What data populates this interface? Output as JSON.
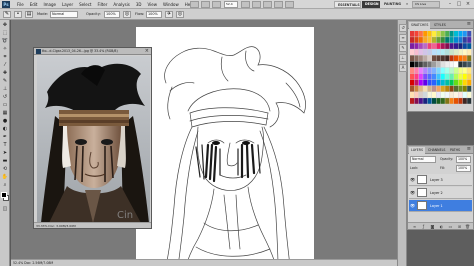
{
  "app": {
    "logo": "Ps",
    "menus": [
      "File",
      "Edit",
      "Image",
      "Layer",
      "Select",
      "Filter",
      "Analysis",
      "3D",
      "View",
      "Window",
      "Help"
    ],
    "zoom_select": "52.4",
    "workspaces": {
      "essentials": "ESSENTIALS",
      "design": "DESIGN",
      "painting": "PAINTING",
      "more": "»"
    },
    "cs_live": "CS Live",
    "window_controls": {
      "minimize": "–",
      "maximize": "□",
      "close": "×"
    }
  },
  "options": {
    "mode_label": "Mode:",
    "mode_value": "Normal",
    "opacity_label": "Opacity:",
    "opacity_value": "100%",
    "flow_label": "Flow:",
    "flow_value": "100%"
  },
  "reference_window": {
    "title": "tto...d-Cigar-2013_04-26...jpg @ 33.4% (RGB/8)",
    "status": "33.33%   Doc: 3.00M/3.00M"
  },
  "status_bar": {
    "text": "52.4%   Doc: 2.56M/7.08M"
  },
  "swatches_panel": {
    "tabs": [
      "SWATCHES",
      "STYLES"
    ],
    "colors": [
      "#e53935",
      "#f44336",
      "#ff7043",
      "#ff9800",
      "#ffc107",
      "#ffeb3b",
      "#cddc39",
      "#8bc34a",
      "#4caf50",
      "#009688",
      "#00bcd4",
      "#03a9f4",
      "#2196f3",
      "#3f51b5",
      "#c62828",
      "#d84315",
      "#ef6c00",
      "#f9a825",
      "#fbc02d",
      "#afb42b",
      "#689f38",
      "#388e3c",
      "#00796b",
      "#0097a7",
      "#0288d1",
      "#1976d2",
      "#303f9f",
      "#512da8",
      "#7b1fa2",
      "#8e24aa",
      "#ab47bc",
      "#ba68c8",
      "#ec407a",
      "#f06292",
      "#e91e63",
      "#ad1457",
      "#880e4f",
      "#4a148c",
      "#311b92",
      "#1a237e",
      "#0d47a1",
      "#01579b",
      "#ffcdd2",
      "#f8bbd0",
      "#e1bee7",
      "#d1c4e9",
      "#c5cae9",
      "#bbdefb",
      "#b3e5fc",
      "#b2ebf2",
      "#b2dfdb",
      "#c8e6c9",
      "#dcedc8",
      "#f0f4c3",
      "#fff9c4",
      "#ffecb3",
      "#795548",
      "#8d6e63",
      "#a1887f",
      "#bcaaa4",
      "#d7ccc8",
      "#6d4c41",
      "#5d4037",
      "#4e342e",
      "#3e2723",
      "#bf360c",
      "#e65100",
      "#ff6f00",
      "#f57f17",
      "#827717",
      "#000000",
      "#212121",
      "#424242",
      "#616161",
      "#757575",
      "#9e9e9e",
      "#bdbdbd",
      "#e0e0e0",
      "#eeeeee",
      "#f5f5f5",
      "#ffffff",
      "#263238",
      "#37474f",
      "#455a64",
      "#ff8a80",
      "#ff80ab",
      "#ea80fc",
      "#b388ff",
      "#8c9eff",
      "#82b1ff",
      "#80d8ff",
      "#84ffff",
      "#a7ffeb",
      "#b9f6ca",
      "#ccff90",
      "#f4ff81",
      "#ffff8d",
      "#ffe57f",
      "#ff5252",
      "#ff4081",
      "#e040fb",
      "#7c4dff",
      "#536dfe",
      "#448aff",
      "#40c4ff",
      "#18ffff",
      "#64ffda",
      "#69f0ae",
      "#b2ff59",
      "#eeff41",
      "#ffff00",
      "#ffd740",
      "#d50000",
      "#c51162",
      "#aa00ff",
      "#6200ea",
      "#304ffe",
      "#2962ff",
      "#0091ea",
      "#00b8d4",
      "#00bfa5",
      "#00c853",
      "#64dd17",
      "#aeea00",
      "#ffd600",
      "#ffab00",
      "#a0522d",
      "#cd853f",
      "#deb887",
      "#f5deb3",
      "#d2b48c",
      "#bc8f8f",
      "#f4a460",
      "#daa520",
      "#b8860b",
      "#8b4513",
      "#556b2f",
      "#6b8e23",
      "#808000",
      "#2f4f4f",
      "#ffe0b2",
      "#ffccbc",
      "#d7ccc8",
      "#cfd8dc",
      "#f5f5dc",
      "#fffacd",
      "#e6e6fa",
      "#f0fff0",
      "#f0f8ff",
      "#faebd7",
      "#fdf5e6",
      "#ffe4e1",
      "#e0ffff",
      "#fafad2",
      "#b71c1c",
      "#880e4f",
      "#4a148c",
      "#1a237e",
      "#01579b",
      "#004d40",
      "#1b5e20",
      "#33691e",
      "#827717",
      "#f57f17",
      "#e65100",
      "#bf360c",
      "#3e2723",
      "#263238"
    ]
  },
  "layers_panel": {
    "tabs": [
      "LAYERS",
      "CHANNELS",
      "PATHS"
    ],
    "blend_mode": "Normal",
    "opacity_label": "Opacity:",
    "opacity_value": "100%",
    "lock_label": "Lock:",
    "fill_label": "Fill:",
    "fill_value": "100%",
    "layers": [
      {
        "name": "Layer 3",
        "selected": false
      },
      {
        "name": "Layer 2",
        "selected": false
      },
      {
        "name": "Layer 1",
        "selected": true
      }
    ]
  }
}
